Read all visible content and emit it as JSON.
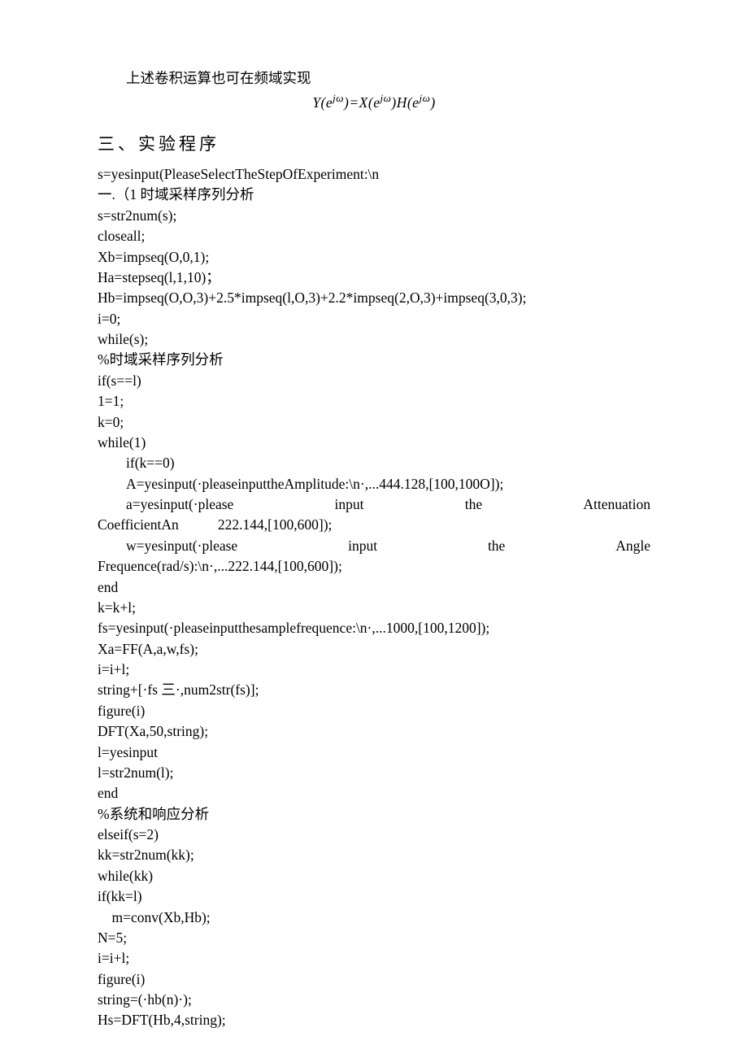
{
  "p1": "上述卷积运算也可在频域实现",
  "formula": {
    "y": "Y(e",
    "exp": "jω",
    "eq": ")=X(e",
    "h": ")H(e",
    "close": ")"
  },
  "section": "三、实验程序",
  "code": {
    "l1": "s=yesinput(PleaseSelectTheStepOfExperiment:\\n",
    "l2": "一.（1 时域采样序列分析",
    "l3": "s=str2num(s);",
    "l4": "closeall;",
    "l5": "Xb=impseq(O,0,1);",
    "l6": "Ha=stepseq(l,1,10)；",
    "l7": "Hb=impseq(O,O,3)+2.5*impseq(l,O,3)+2.2*impseq(2,O,3)+impseq(3,0,3);",
    "l8": "i=0;",
    "l9": "while(s);",
    "l10": "%时域采样序列分析",
    "l11": "if(s==l)",
    "l12": "1=1;",
    "l13": "k=0;",
    "l14": "while(1)",
    "l15": "if(k==0)",
    "l16": "A=yesinput(·pleaseinputtheAmplitude:\\n·,...444.128,[100,100O]);",
    "l17a": "a=yesinput(·please",
    "l17b": "input",
    "l17c": "the",
    "l17d": "Attenuation",
    "l18": "CoefficientAn           222.144,[100,600]);",
    "l19a": "w=yesinput(·please",
    "l19b": "input",
    "l19c": "the",
    "l19d": "Angle",
    "l20": "Frequence(rad/s):\\n·,...222.144,[100,600]);",
    "l21": "end",
    "l22": "k=k+l;",
    "l23": "fs=yesinput(·pleaseinputthesamplefrequence:\\n·,...1000,[100,1200]);",
    "l24": "Xa=FF(A,a,w,fs);",
    "l25": "i=i+l;",
    "l26": "string+[·fs 三·,num2str(fs)];",
    "l27": "figure(i)",
    "l28": "DFT(Xa,50,string);",
    "l29": "l=yesinput",
    "l30": "l=str2num(l);",
    "l31": "end",
    "l32": "%系统和响应分析",
    "l33": "elseif(s=2)",
    "l34": "kk=str2num(kk);",
    "l35": "while(kk)",
    "l36": "if(kk=l)",
    "l37": "m=conv(Xb,Hb);",
    "l38": "N=5;",
    "l39": "i=i+l;",
    "l40": "figure(i)",
    "l41": "string=(·hb(n)·);",
    "l42": "Hs=DFT(Hb,4,string);"
  }
}
